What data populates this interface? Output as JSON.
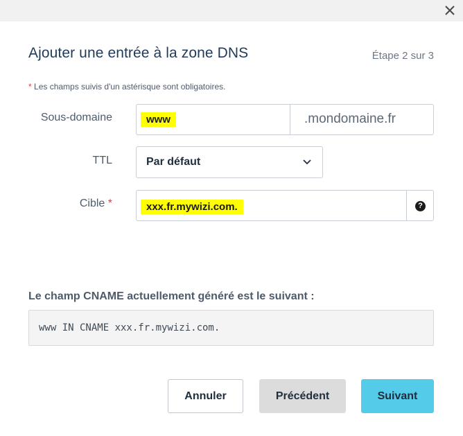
{
  "dialog": {
    "title": "Ajouter une entrée à la zone DNS",
    "step": "Étape 2 sur 3",
    "required_note_star": "*",
    "required_note": "Les champs suivis d'un astérisque sont obligatoires."
  },
  "form": {
    "subdomain": {
      "label": "Sous-domaine",
      "value": "www",
      "suffix": ".mondomaine.fr"
    },
    "ttl": {
      "label": "TTL",
      "value": "Par défaut"
    },
    "target": {
      "label": "Cible",
      "required_star": "*",
      "value": "xxx.fr.mywizi.com.",
      "help_icon": "question-circle-icon"
    }
  },
  "cname": {
    "heading": "Le champ CNAME actuellement généré est le suivant :",
    "record": "www IN CNAME xxx.fr.mywizi.com."
  },
  "buttons": {
    "cancel": "Annuler",
    "previous": "Précédent",
    "next": "Suivant"
  },
  "colors": {
    "highlight": "#ffff00",
    "primary_button": "#55cbea",
    "secondary_button": "#dcdcdc",
    "title": "#1f3a5a",
    "required_star": "#e23c3c"
  }
}
